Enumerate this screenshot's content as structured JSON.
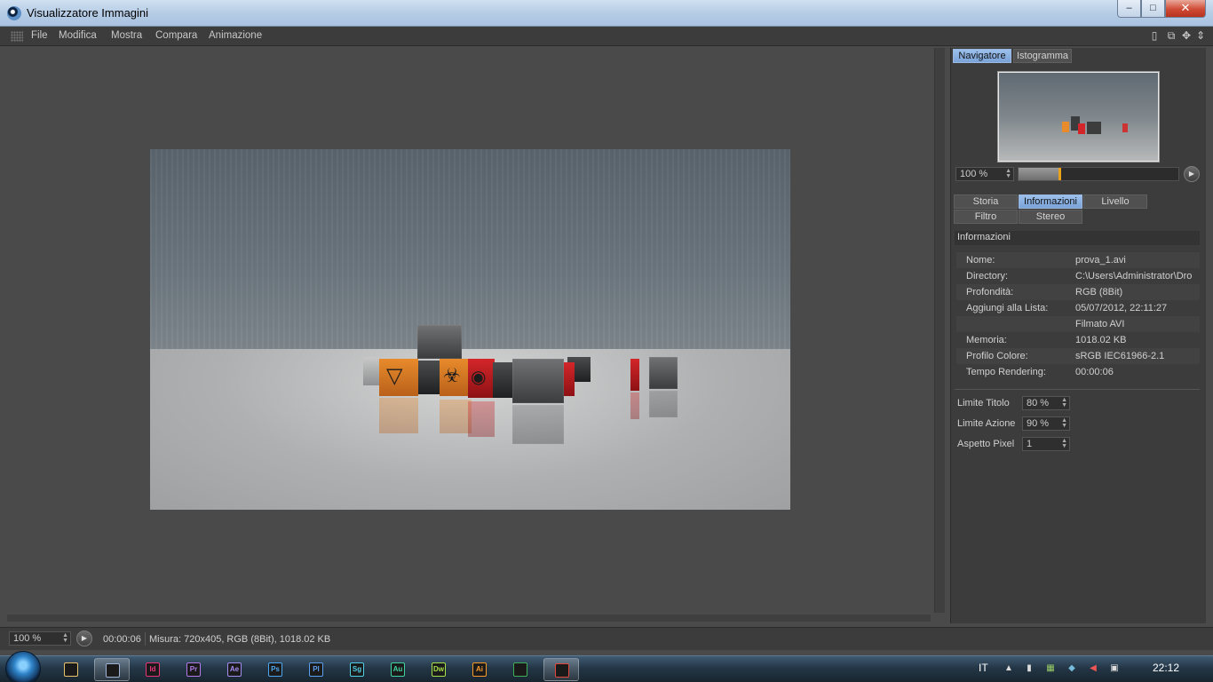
{
  "window": {
    "title": "Visualizzatore Immagini"
  },
  "menu": [
    "File",
    "Modifica",
    "Mostra",
    "Compara",
    "Animazione"
  ],
  "navigator": {
    "tabs": [
      "Navigatore",
      "Istogramma"
    ],
    "zoom": "100 %",
    "zoom_slider_fraction": 0.25
  },
  "tabs_row1": [
    "Storia",
    "Informazioni",
    "Livello"
  ],
  "tabs_row2": [
    "Filtro",
    "Stereo"
  ],
  "info": {
    "heading": "Informazioni",
    "rows": [
      {
        "key": "Nome:",
        "value": "prova_1.avi"
      },
      {
        "key": "Directory:",
        "value": "C:\\Users\\Administrator\\Dro"
      },
      {
        "key": "Profondità:",
        "value": "RGB (8Bit)"
      },
      {
        "key": "Aggiungi alla Lista:",
        "value": "05/07/2012, 22:11:27"
      },
      {
        "key": "",
        "value": "Filmato AVI"
      },
      {
        "key": "Memoria:",
        "value": "1018.02 KB"
      },
      {
        "key": "Profilo Colore:",
        "value": "sRGB IEC61966-2.1"
      },
      {
        "key": "Tempo Rendering:",
        "value": "00:00:06"
      }
    ]
  },
  "params": [
    {
      "label": "Limite Titolo",
      "value": "80 %"
    },
    {
      "label": "Limite Azione",
      "value": "90 %"
    },
    {
      "label": "Aspetto Pixel",
      "value": "1"
    }
  ],
  "status": {
    "zoom": "100 %",
    "time": "00:00:06",
    "info": "Misura: 720x405, RGB (8Bit), 1018.02 KB"
  },
  "taskbar": {
    "apps": [
      {
        "name": "explorer",
        "label": "",
        "color": "#e8c26a"
      },
      {
        "name": "cinema4d",
        "label": "",
        "color": "#9fb4d6"
      },
      {
        "name": "indesign",
        "label": "Id",
        "color": "#e8347a"
      },
      {
        "name": "premiere",
        "label": "Pr",
        "color": "#b07ae8"
      },
      {
        "name": "aftereffects",
        "label": "Ae",
        "color": "#a48cf0"
      },
      {
        "name": "photoshop",
        "label": "Ps",
        "color": "#4fa8ef"
      },
      {
        "name": "prelude",
        "label": "Pl",
        "color": "#5aa0ef"
      },
      {
        "name": "speedgrade",
        "label": "Sg",
        "color": "#4fd0e6"
      },
      {
        "name": "audition",
        "label": "Au",
        "color": "#3fd3a0"
      },
      {
        "name": "dreamweaver",
        "label": "Dw",
        "color": "#a6e04a"
      },
      {
        "name": "illustrator",
        "label": "Ai",
        "color": "#f59a2a"
      },
      {
        "name": "excel",
        "label": "",
        "color": "#3fae5a"
      },
      {
        "name": "chrome",
        "label": "",
        "color": "#e2473c"
      }
    ],
    "language": "IT",
    "clock": "22:12"
  }
}
